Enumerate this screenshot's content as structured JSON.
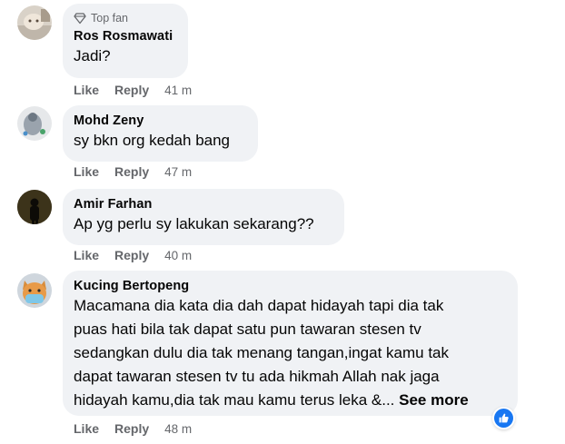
{
  "comments": [
    {
      "badge": "Top fan",
      "author": "Ros Rosmawati",
      "lines": [
        "Jadi?"
      ],
      "actions": {
        "like": "Like",
        "reply": "Reply",
        "time": "41 m"
      }
    },
    {
      "author": "Mohd Zeny",
      "lines": [
        "sy bkn org kedah bang"
      ],
      "actions": {
        "like": "Like",
        "reply": "Reply",
        "time": "47 m"
      }
    },
    {
      "author": "Amir Farhan",
      "lines": [
        "Ap yg perlu sy lakukan sekarang??"
      ],
      "actions": {
        "like": "Like",
        "reply": "Reply",
        "time": "40 m"
      }
    },
    {
      "author": "Kucing Bertopeng",
      "lines": [
        "Macamana dia kata dia dah dapat hidayah tapi dia tak",
        "puas hati bila tak dapat satu pun tawaran stesen tv",
        "sedangkan dulu dia tak menang tangan,ingat kamu tak",
        "dapat tawaran stesen tv tu ada hikmah Allah nak jaga",
        "hidayah kamu,dia tak mau kamu terus leka &... "
      ],
      "see_more": "See more",
      "actions": {
        "like": "Like",
        "reply": "Reply",
        "time": "48 m"
      },
      "reaction": "like-reaction-icon"
    }
  ],
  "colors": {
    "bubble": "#f0f2f5",
    "secondary_text": "#65676b",
    "like_blue": "#1877f2"
  }
}
